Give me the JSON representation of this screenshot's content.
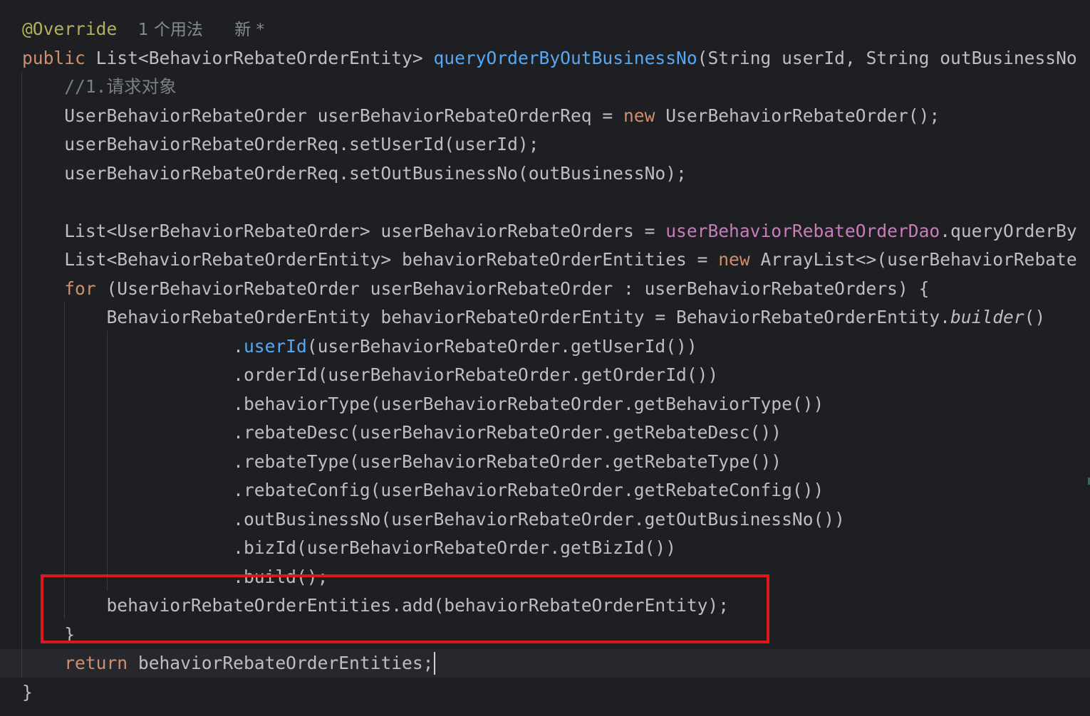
{
  "code_lines": [
    [
      {
        "t": "@Override",
        "c": "ann"
      },
      {
        "t": "  ",
        "c": ""
      },
      {
        "t": "1 个用法",
        "c": "hint"
      },
      {
        "t": "   ",
        "c": ""
      },
      {
        "t": "新 *",
        "c": "hint"
      }
    ],
    [
      {
        "t": "public ",
        "c": "kw"
      },
      {
        "t": "List<BehaviorRebateOrderEntity> ",
        "c": ""
      },
      {
        "t": "queryOrderByOutBusinessNo",
        "c": "fn"
      },
      {
        "t": "(String userId, String outBusinessNo",
        "c": ""
      }
    ],
    [
      {
        "t": "    //1.请求对象",
        "c": "cm"
      }
    ],
    [
      {
        "t": "    UserBehaviorRebateOrder userBehaviorRebateOrderReq = ",
        "c": ""
      },
      {
        "t": "new ",
        "c": "kw"
      },
      {
        "t": "UserBehaviorRebateOrder();",
        "c": ""
      }
    ],
    [
      {
        "t": "    userBehaviorRebateOrderReq.setUserId(userId);",
        "c": ""
      }
    ],
    [
      {
        "t": "    userBehaviorRebateOrderReq.setOutBusinessNo(outBusinessNo);",
        "c": ""
      }
    ],
    [],
    [
      {
        "t": "    List<UserBehaviorRebateOrder> userBehaviorRebateOrders = ",
        "c": ""
      },
      {
        "t": "userBehaviorRebateOrderDao",
        "c": "field"
      },
      {
        "t": ".queryOrderBy",
        "c": ""
      }
    ],
    [
      {
        "t": "    List<BehaviorRebateOrderEntity> behaviorRebateOrderEntities = ",
        "c": ""
      },
      {
        "t": "new ",
        "c": "kw"
      },
      {
        "t": "ArrayList<>(userBehaviorRebate",
        "c": ""
      }
    ],
    [
      {
        "t": "    ",
        "c": ""
      },
      {
        "t": "for ",
        "c": "kw"
      },
      {
        "t": "(UserBehaviorRebateOrder userBehaviorRebateOrder : userBehaviorRebateOrders) {",
        "c": ""
      }
    ],
    [
      {
        "t": "        BehaviorRebateOrderEntity behaviorRebateOrderEntity = BehaviorRebateOrderEntity.",
        "c": ""
      },
      {
        "t": "builder",
        "c": "it"
      },
      {
        "t": "()",
        "c": ""
      }
    ],
    [
      {
        "t": "                    .",
        "c": ""
      },
      {
        "t": "userId",
        "c": "fn"
      },
      {
        "t": "(userBehaviorRebateOrder.getUserId())",
        "c": ""
      }
    ],
    [
      {
        "t": "                    .orderId(userBehaviorRebateOrder.getOrderId())",
        "c": ""
      }
    ],
    [
      {
        "t": "                    .behaviorType(userBehaviorRebateOrder.getBehaviorType())",
        "c": ""
      }
    ],
    [
      {
        "t": "                    .rebateDesc(userBehaviorRebateOrder.getRebateDesc())",
        "c": ""
      }
    ],
    [
      {
        "t": "                    .rebateType(userBehaviorRebateOrder.getRebateType())",
        "c": ""
      }
    ],
    [
      {
        "t": "                    .rebateConfig(userBehaviorRebateOrder.getRebateConfig())",
        "c": ""
      }
    ],
    [
      {
        "t": "                    .outBusinessNo(userBehaviorRebateOrder.getOutBusinessNo())",
        "c": ""
      }
    ],
    [
      {
        "t": "                    .bizId(userBehaviorRebateOrder.getBizId())",
        "c": ""
      }
    ],
    [
      {
        "t": "                    .build();",
        "c": ""
      }
    ],
    [
      {
        "t": "        behaviorRebateOrderEntities.add(behaviorRebateOrderEntity);",
        "c": ""
      }
    ],
    [
      {
        "t": "    }",
        "c": ""
      }
    ],
    [
      {
        "t": "    ",
        "c": ""
      },
      {
        "t": "return ",
        "c": "kw"
      },
      {
        "t": "behaviorRebateOrderEntities;",
        "c": ""
      }
    ],
    [
      {
        "t": "}",
        "c": ""
      }
    ]
  ],
  "current_line_index": 22,
  "highlight_annotation_color": "#e0161c",
  "theme": {
    "background": "#1e1f22",
    "text": "#bcbec4",
    "keyword": "#cf8e6d",
    "function": "#56a8f5",
    "annotation": "#b3ae60",
    "field": "#c77dbb",
    "comment": "#7a7e85"
  }
}
